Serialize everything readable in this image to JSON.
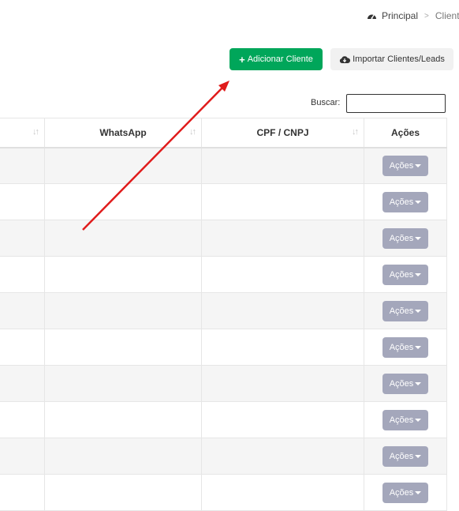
{
  "breadcrumb": {
    "items": [
      "Principal",
      "Clientes"
    ]
  },
  "toolbar": {
    "add_label": "Adicionar Cliente",
    "import_label": "Importar Clientes/Leads"
  },
  "search": {
    "label": "Buscar:",
    "value": ""
  },
  "table": {
    "columns": [
      "",
      "WhatsApp",
      "CPF / CNPJ",
      "Ações"
    ],
    "row_action_label": "Ações",
    "row_count": 10
  },
  "colors": {
    "primary_button": "#00a65a",
    "action_button": "#a4a7bb",
    "annotation_arrow": "#e01b1b"
  },
  "icons": [
    "dashboard-icon",
    "plus-icon",
    "cloud-download-icon",
    "sort-icon",
    "caret-down-icon"
  ]
}
